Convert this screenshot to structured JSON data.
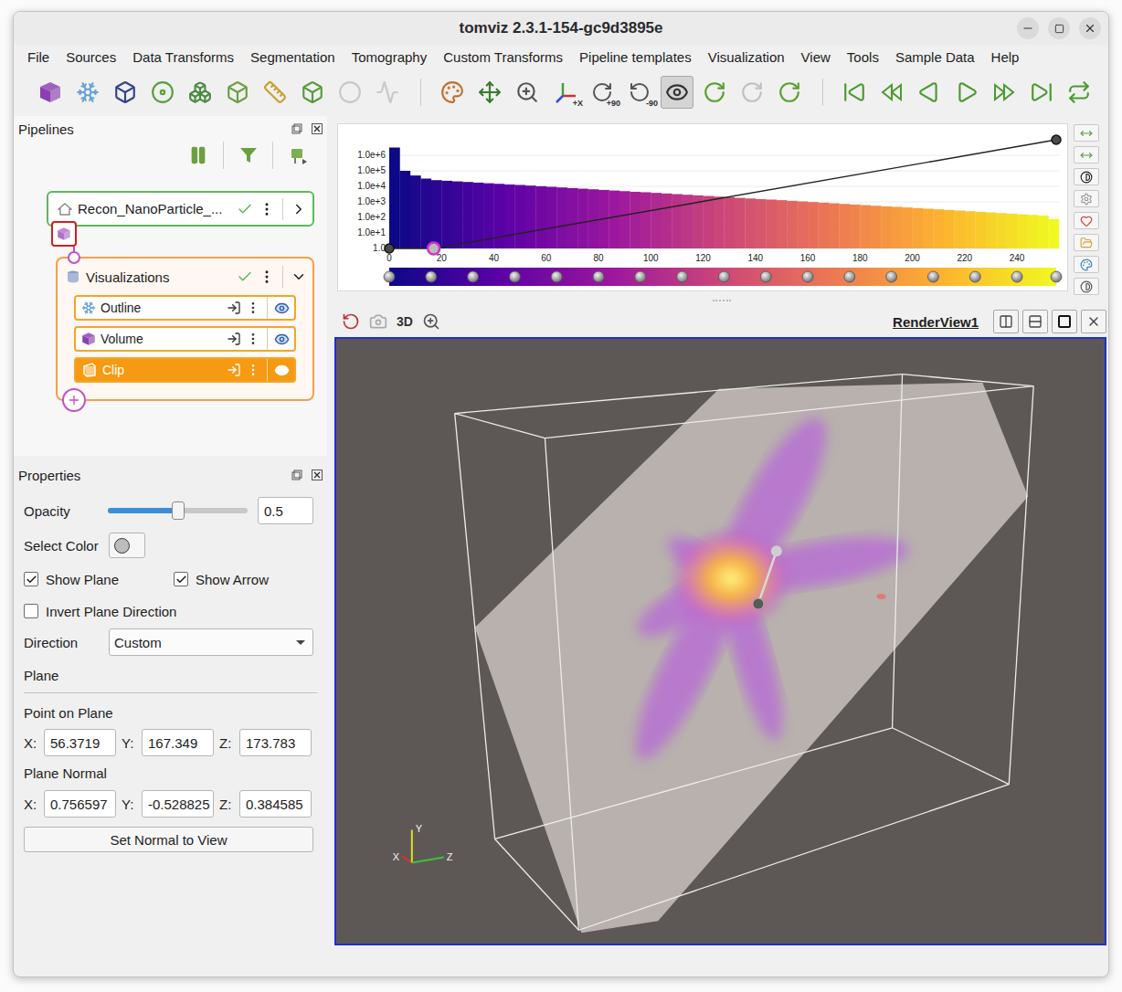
{
  "window": {
    "title": "tomviz 2.3.1-154-gc9d3895e"
  },
  "menu": [
    "File",
    "Sources",
    "Data Transforms",
    "Segmentation",
    "Tomography",
    "Custom Transforms",
    "Pipeline templates",
    "Visualization",
    "View",
    "Tools",
    "Sample Data",
    "Help"
  ],
  "toolbar": [
    [
      {
        "pressed": false,
        "disabled": false
      },
      {
        "pressed": false,
        "disabled": false
      },
      {
        "pressed": false,
        "disabled": false
      },
      {
        "pressed": false,
        "disabled": false
      },
      {
        "pressed": false,
        "disabled": false
      },
      {
        "pressed": false,
        "disabled": false
      },
      {
        "pressed": false,
        "disabled": false
      },
      {
        "pressed": false,
        "disabled": false
      },
      {
        "pressed": false,
        "disabled": true
      },
      {
        "pressed": false,
        "disabled": true
      }
    ],
    [
      {
        "pressed": false,
        "disabled": false
      },
      {
        "pressed": false,
        "disabled": false
      },
      {
        "pressed": false,
        "disabled": false
      },
      {
        "pressed": false,
        "disabled": false,
        "badge": "+X"
      },
      {
        "pressed": false,
        "disabled": false,
        "badge": "+90"
      },
      {
        "pressed": false,
        "disabled": false,
        "badge": "-90"
      },
      {
        "pressed": true,
        "disabled": false
      },
      {
        "pressed": false,
        "disabled": false
      },
      {
        "pressed": false,
        "disabled": true
      },
      {
        "pressed": false,
        "disabled": false
      }
    ],
    [
      {
        "pressed": false,
        "disabled": false
      },
      {
        "pressed": false,
        "disabled": false
      },
      {
        "pressed": false,
        "disabled": false
      },
      {
        "pressed": false,
        "disabled": false
      },
      {
        "pressed": false,
        "disabled": false
      },
      {
        "pressed": false,
        "disabled": false
      },
      {
        "pressed": false,
        "disabled": false
      }
    ]
  ],
  "pipelines": {
    "title": "Pipelines",
    "source": {
      "name": "Recon_NanoParticle_...",
      "ok": true
    },
    "group": {
      "name": "Visualizations",
      "ok": true,
      "expanded": true,
      "items": [
        {
          "name": "Outline",
          "visible": true,
          "selected": false
        },
        {
          "name": "Volume",
          "visible": true,
          "selected": false
        },
        {
          "name": "Clip",
          "visible": true,
          "selected": true
        }
      ]
    }
  },
  "properties": {
    "title": "Properties",
    "opacity": {
      "label": "Opacity",
      "level": 0.5,
      "value": "0.5"
    },
    "color": {
      "label": "Select Color",
      "swatch": "#bdbdbd"
    },
    "checks": [
      {
        "label": "Show Plane",
        "checked": true
      },
      {
        "label": "Show Arrow",
        "checked": true
      }
    ],
    "invert": {
      "label": "Invert Plane Direction",
      "checked": false
    },
    "direction": {
      "label": "Direction",
      "value": "Custom"
    },
    "section": "Plane",
    "point": {
      "label": "Point on Plane",
      "fields": [
        {
          "axis": "X:",
          "value": "56.3719"
        },
        {
          "axis": "Y:",
          "value": "167.349"
        },
        {
          "axis": "Z:",
          "value": "173.783"
        }
      ]
    },
    "normal": {
      "label": "Plane Normal",
      "fields": [
        {
          "axis": "X:",
          "value": "0.756597"
        },
        {
          "axis": "Y:",
          "value": "-0.528825"
        },
        {
          "axis": "Z:",
          "value": "0.384585"
        }
      ]
    },
    "button": "Set Normal to View"
  },
  "histogram": {
    "yTicks": [
      "1.0e+6",
      "1.0e+5",
      "1.0e+4",
      "1.0e+3",
      "1.0e+2",
      "1.0e+1",
      "1.0"
    ],
    "xTicks": [
      "0",
      "20",
      "40",
      "60",
      "80",
      "100",
      "120",
      "140",
      "160",
      "180",
      "200",
      "220",
      "240"
    ],
    "bins": [
      3160000,
      100000,
      50000,
      31600,
      25100,
      22900,
      20900,
      19100,
      17400,
      15800,
      14500,
      13200,
      12300,
      11200,
      10200,
      9330,
      8510,
      7760,
      7080,
      6460,
      5890,
      5370,
      4900,
      4470,
      4170,
      3800,
      3470,
      3160,
      2880,
      2630,
      2400,
      2190,
      2000,
      1820,
      1660,
      1510,
      1410,
      1290,
      1170,
      1070,
      977,
      891,
      813,
      741,
      676,
      617,
      562,
      513,
      479,
      437,
      398,
      363,
      331,
      302,
      275,
      251,
      229,
      209,
      191,
      174,
      158,
      145,
      132,
      79
    ],
    "opacityPoints": [
      {
        "value": 0,
        "opacity": 0,
        "selected": false
      },
      {
        "value": 17,
        "opacity": 0,
        "selected": true
      },
      {
        "value": 255,
        "opacity": 1,
        "selected": false
      }
    ],
    "colorStops": [
      0,
      16,
      32,
      48,
      64,
      80,
      96,
      112,
      128,
      144,
      160,
      176,
      192,
      208,
      224,
      240,
      255
    ]
  },
  "view": {
    "mode": "3D",
    "name": "RenderView1",
    "axes": [
      {
        "label": "X",
        "color": "#e03030"
      },
      {
        "label": "Y",
        "color": "#e0e020"
      },
      {
        "label": "Z",
        "color": "#40c040"
      }
    ]
  }
}
